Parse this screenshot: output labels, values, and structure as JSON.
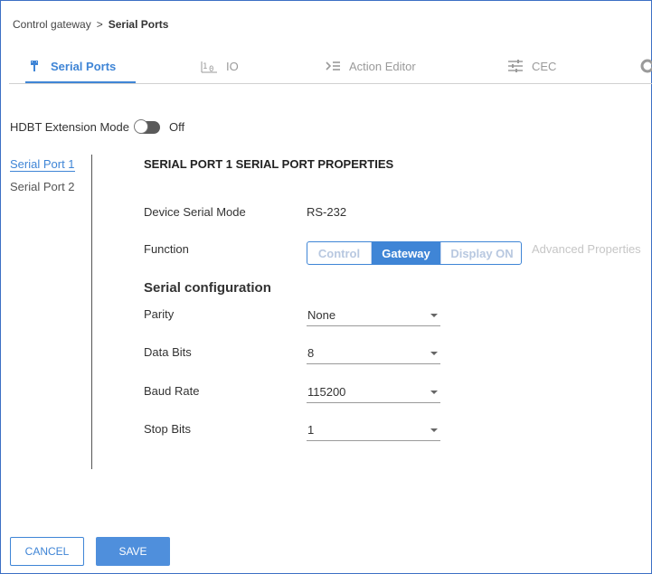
{
  "breadcrumb": {
    "parent": "Control gateway",
    "separator": ">",
    "current": "Serial Ports"
  },
  "tabs": [
    {
      "label": "Serial Ports",
      "icon": "serial-port-icon",
      "active": true
    },
    {
      "label": "IO",
      "icon": "io-icon",
      "active": false
    },
    {
      "label": "Action Editor",
      "icon": "action-editor-icon",
      "active": false
    },
    {
      "label": "CEC",
      "icon": "sliders-icon",
      "active": false
    }
  ],
  "hdbt": {
    "label": "HDBT Extension Mode",
    "state": "Off"
  },
  "ports": [
    {
      "label": "Serial Port 1",
      "active": true
    },
    {
      "label": "Serial Port 2",
      "active": false
    }
  ],
  "panel": {
    "title": "SERIAL PORT 1 SERIAL PORT PROPERTIES",
    "device_mode_label": "Device Serial Mode",
    "device_mode_value": "RS-232",
    "function_label": "Function",
    "function_options": [
      "Control",
      "Gateway",
      "Display ON"
    ],
    "function_selected": "Gateway",
    "advanced_link": "Advanced Properties",
    "serial_config_title": "Serial configuration",
    "parity_label": "Parity",
    "parity_value": "None",
    "data_bits_label": "Data Bits",
    "data_bits_value": "8",
    "baud_rate_label": "Baud Rate",
    "baud_rate_value": "115200",
    "stop_bits_label": "Stop Bits",
    "stop_bits_value": "1"
  },
  "buttons": {
    "cancel": "CANCEL",
    "save": "SAVE"
  },
  "colors": {
    "accent": "#3f85d6",
    "save_bg": "#4f8fdc"
  }
}
